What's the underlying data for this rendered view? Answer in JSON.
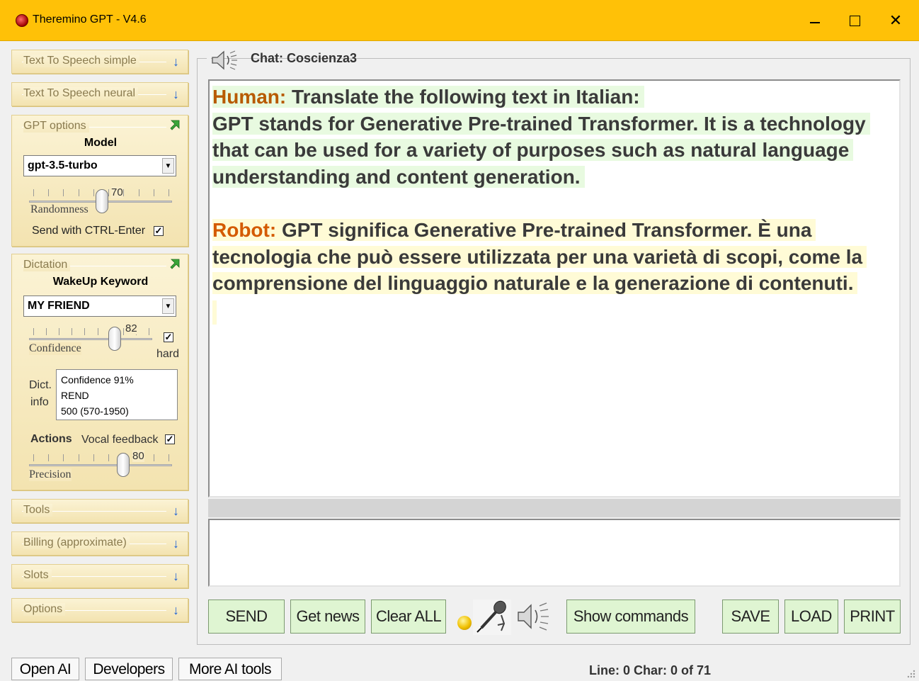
{
  "window": {
    "title": "Theremino GPT - V4.6",
    "accent_color": "#ffc107",
    "controls": [
      "minimize-icon",
      "maximize-icon",
      "close-icon"
    ],
    "close_glyph": "✕"
  },
  "sidebar": {
    "panels": {
      "tts_simple": {
        "label": "Text To Speech simple",
        "state": "collapsed"
      },
      "tts_neural": {
        "label": "Text To Speech neural",
        "state": "collapsed"
      },
      "gpt_options": {
        "label": "GPT options",
        "model_label": "Model",
        "model_value": "gpt-3.5-turbo",
        "randomness_label": "Randomness",
        "randomness_value": "70",
        "send_ctrl_label": "Send with CTRL-Enter",
        "send_ctrl_checked": true
      },
      "dictation": {
        "label": "Dictation",
        "wakeup_label": "WakeUp Keyword",
        "wakeup_value": "MY FRIEND",
        "confidence_label": "Confidence",
        "confidence_value": "82",
        "hard_label": "hard",
        "hard_checked": true,
        "dict_label": "Dict.",
        "info_label": "info",
        "info_lines": [
          "Confidence 91%",
          "REND",
          "500 (570-1950)"
        ],
        "actions_label": "Actions",
        "vocal_feedback_label": "Vocal feedback",
        "vocal_feedback_checked": true,
        "precision_label": "Precision",
        "precision_value": "80"
      },
      "tools": {
        "label": "Tools",
        "state": "collapsed"
      },
      "billing": {
        "label": "Billing (approximate)",
        "state": "collapsed"
      },
      "slots": {
        "label": "Slots",
        "state": "collapsed"
      },
      "options": {
        "label": "Options",
        "state": "collapsed"
      }
    },
    "check_glyph": "✓",
    "down_arrow_glyph": "↓",
    "dropdown_glyph": "▼"
  },
  "chat": {
    "title": "Chat: Coscienza3",
    "human_label": "Human:",
    "human_line1": "Translate the following text in Italian:",
    "human_line2": "GPT stands for Generative Pre-trained Transformer. It is a technology",
    "human_line3": "that can be used for a variety of purposes such as natural language",
    "human_line4": "understanding and content generation.",
    "robot_label": "Robot:",
    "robot_line1": "GPT significa Generative Pre-trained Transformer. È una",
    "robot_line2": "tecnologia che può essere utilizzata per una varietà di scopi, come la",
    "robot_line3": "comprensione del linguaggio naturale e la generazione di contenuti.",
    "human_color": "#b85a00",
    "robot_color": "#d45a00",
    "input_value": ""
  },
  "buttons": {
    "send": "SEND",
    "get_news": "Get news",
    "clear_all": "Clear ALL",
    "show_commands": "Show commands",
    "save": "SAVE",
    "load": "LOAD",
    "print": "PRINT"
  },
  "icons": {
    "led": "status-led-icon",
    "mic": "microphone-icon",
    "speaker": "speaker-icon"
  },
  "footer": {
    "open_ai": "Open AI",
    "developers": "Developers",
    "more_ai_tools": "More AI tools",
    "status": "Line: 0  Char: 0 of 71"
  }
}
